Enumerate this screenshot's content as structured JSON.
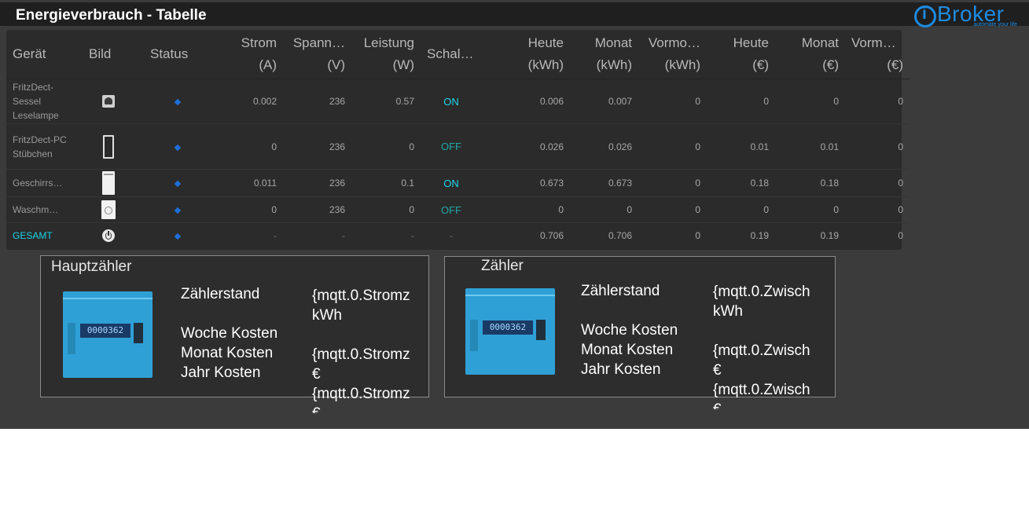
{
  "app": {
    "title": "Energieverbrauch - Tabelle",
    "logo_text": "Broker",
    "logo_slogan": "automate your life"
  },
  "table": {
    "headers": [
      {
        "line1": "Gerät",
        "line2": ""
      },
      {
        "line1": "Bild",
        "line2": ""
      },
      {
        "line1": "Status",
        "line2": ""
      },
      {
        "line1": "Strom",
        "line2": "(A)"
      },
      {
        "line1": "Spann…",
        "line2": "(V)"
      },
      {
        "line1": "Leistung",
        "line2": "(W)"
      },
      {
        "line1": "Schalter",
        "line2": ""
      },
      {
        "line1": "Heute",
        "line2": "(kWh)"
      },
      {
        "line1": "Monat",
        "line2": "(kWh)"
      },
      {
        "line1": "Vormo…",
        "line2": "(kWh)"
      },
      {
        "line1": "Heute",
        "line2": "(€)"
      },
      {
        "line1": "Monat",
        "line2": "(€)"
      },
      {
        "line1": "Vormo…",
        "line2": "(€)"
      }
    ],
    "rows": [
      {
        "name": "FritzDect-Sessel Leselampe",
        "image_icon": "lamp-icon",
        "strom": "0.002",
        "spannung": "236",
        "leistung": "0.57",
        "schalter": "ON",
        "heute_kwh": "0.006",
        "monat_kwh": "0.007",
        "vormonat_kwh": "0",
        "heute_eur": "0",
        "monat_eur": "0",
        "vormonat_eur": "0"
      },
      {
        "name": "FritzDect-PC Stübchen",
        "image_icon": "pc-tower-icon",
        "strom": "0",
        "spannung": "236",
        "leistung": "0",
        "schalter": "OFF",
        "heute_kwh": "0.026",
        "monat_kwh": "0.026",
        "vormonat_kwh": "0",
        "heute_eur": "0.01",
        "monat_eur": "0.01",
        "vormonat_eur": "0"
      },
      {
        "name": "Geschirrs…",
        "image_icon": "dishwasher-icon",
        "strom": "0.011",
        "spannung": "236",
        "leistung": "0.1",
        "schalter": "ON",
        "heute_kwh": "0.673",
        "monat_kwh": "0.673",
        "vormonat_kwh": "0",
        "heute_eur": "0.18",
        "monat_eur": "0.18",
        "vormonat_eur": "0"
      },
      {
        "name": "Waschm…",
        "image_icon": "washing-machine-icon",
        "strom": "0",
        "spannung": "236",
        "leistung": "0",
        "schalter": "OFF",
        "heute_kwh": "0",
        "monat_kwh": "0",
        "vormonat_kwh": "0",
        "heute_eur": "0",
        "monat_eur": "0",
        "vormonat_eur": "0"
      },
      {
        "name": "GESAMT",
        "image_icon": "power-icon",
        "strom": "-",
        "spannung": "-",
        "leistung": "-",
        "schalter": "-",
        "heute_kwh": "0.706",
        "monat_kwh": "0.706",
        "vormonat_kwh": "0",
        "heute_eur": "0.19",
        "monat_eur": "0.19",
        "vormonat_eur": "0"
      }
    ]
  },
  "meters": [
    {
      "title": "Hauptzähler",
      "lcd": "0000362",
      "labels": [
        "Zählerstand",
        "Woche Kosten",
        "Monat Kosten",
        "Jahr Kosten"
      ],
      "values": [
        "{mqtt.0.Stromz",
        "kWh",
        "{mqtt.0.Stromz",
        "€",
        "{mqtt.0.Stromz",
        "€"
      ]
    },
    {
      "title": "Zähler",
      "lcd": "0000362",
      "labels": [
        "Zählerstand",
        "Woche Kosten",
        "Monat Kosten",
        "Jahr Kosten"
      ],
      "values": [
        "{mqtt.0.Zwisch",
        "kWh",
        "{mqtt.0.Zwisch",
        "€",
        "{mqtt.0.Zwisch",
        "€"
      ]
    }
  ],
  "colors": {
    "background": "#3b3b3b",
    "titlebar": "#1f1f1f",
    "accent": "#1ed6ea",
    "status_diamond": "#1e6fd9",
    "logo": "#1e8be0"
  }
}
